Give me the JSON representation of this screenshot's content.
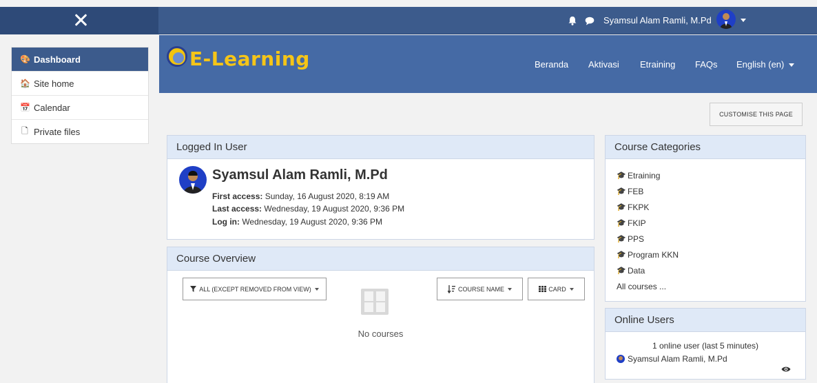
{
  "topbar": {
    "close_icon": "close-icon",
    "user_name": "Syamsul Alam Ramli, M.Pd",
    "notification_icon": "bell-icon",
    "message_icon": "chat-icon"
  },
  "sidebar": {
    "items": [
      {
        "label": "Dashboard",
        "icon": "dashboard-icon",
        "glyph": "🎨",
        "active": true
      },
      {
        "label": "Site home",
        "icon": "home-icon",
        "glyph": "🏠"
      },
      {
        "label": "Calendar",
        "icon": "calendar-icon",
        "glyph": "📅"
      },
      {
        "label": "Private files",
        "icon": "file-icon",
        "glyph": "🗋"
      }
    ]
  },
  "header": {
    "logo_text": "E-Learning",
    "nav": [
      "Beranda",
      "Aktivasi",
      "Etraining",
      "FAQs"
    ],
    "language": "English (en)"
  },
  "customise_button": "CUSTOMISE THIS PAGE",
  "logged_in_user": {
    "title": "Logged In User",
    "full_name": "Syamsul Alam Ramli, M.Pd",
    "first_access_label": "First access:",
    "first_access": " Sunday, 16 August 2020, 8:19 AM",
    "last_access_label": "Last access:",
    "last_access": " Wednesday, 19 August 2020, 9:36 PM",
    "login_label": "Log in:",
    "login": " Wednesday, 19 August 2020, 9:36 PM"
  },
  "course_overview": {
    "title": "Course Overview",
    "filter": "ALL (EXCEPT REMOVED FROM VIEW)",
    "sort": "COURSE NAME",
    "view": "CARD",
    "empty_text": "No courses"
  },
  "course_categories": {
    "title": "Course Categories",
    "items": [
      "Etraining",
      "FEB",
      "FKPK",
      "FKIP",
      "PPS",
      "Program KKN",
      "Data"
    ],
    "all_link": "All courses ..."
  },
  "online_users": {
    "title": "Online Users",
    "summary": "1 online user (last 5 minutes)",
    "users": [
      "Syamsul Alam Ramli, M.Pd"
    ]
  },
  "colors": {
    "navbar": "#3c5b8c",
    "banner": "#456aa5",
    "logo": "#f5c518",
    "block_header": "#dfe9f7"
  }
}
